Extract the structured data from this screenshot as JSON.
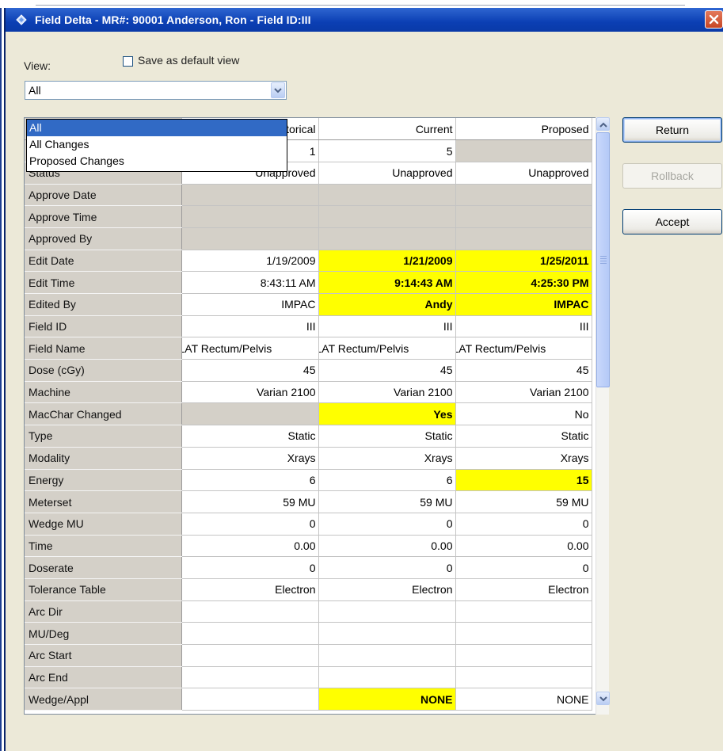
{
  "window": {
    "title": "Field Delta - MR#: 90001   Anderson, Ron - Field ID:III"
  },
  "view": {
    "label": "View:",
    "save_default_label": "Save as default view",
    "save_default_checked": false,
    "selected": "All",
    "options": [
      "All",
      "All Changes",
      "Proposed Changes"
    ]
  },
  "grid": {
    "columns": [
      "",
      "Historical",
      "Current",
      "Proposed"
    ],
    "rows": [
      {
        "label": "",
        "cells": [
          "1",
          "5",
          ""
        ],
        "gray": [
          false,
          false,
          true
        ]
      },
      {
        "label": "Status",
        "cells": [
          "Unapproved",
          "Unapproved",
          "Unapproved"
        ]
      },
      {
        "label": "Approve Date",
        "cells": [
          "",
          "",
          ""
        ],
        "gray": [
          true,
          true,
          true
        ]
      },
      {
        "label": "Approve Time",
        "cells": [
          "",
          "",
          ""
        ],
        "gray": [
          true,
          true,
          true
        ]
      },
      {
        "label": "Approved By",
        "cells": [
          "",
          "",
          ""
        ],
        "gray": [
          true,
          true,
          true
        ]
      },
      {
        "label": "Edit Date",
        "cells": [
          "1/19/2009",
          "1/21/2009",
          "1/25/2011"
        ],
        "hl": [
          false,
          true,
          true
        ]
      },
      {
        "label": "Edit Time",
        "cells": [
          "8:43:11 AM",
          "9:14:43 AM",
          "4:25:30 PM"
        ],
        "hl": [
          false,
          true,
          true
        ]
      },
      {
        "label": "Edited By",
        "cells": [
          "IMPAC",
          "Andy",
          "IMPAC"
        ],
        "hl": [
          false,
          true,
          true
        ]
      },
      {
        "label": "Field ID",
        "cells": [
          "III",
          "III",
          "III"
        ]
      },
      {
        "label": "Field Name",
        "cells": [
          "LAT Rectum/Pelvis",
          "LAT Rectum/Pelvis",
          "LAT Rectum/Pelvis"
        ],
        "clip": true
      },
      {
        "label": "Dose (cGy)",
        "cells": [
          "45",
          "45",
          "45"
        ]
      },
      {
        "label": "Machine",
        "cells": [
          "Varian 2100",
          "Varian 2100",
          "Varian 2100"
        ]
      },
      {
        "label": "MacChar Changed",
        "cells": [
          "",
          "Yes",
          "No"
        ],
        "gray": [
          true,
          false,
          false
        ],
        "hl": [
          false,
          true,
          false
        ]
      },
      {
        "label": "Type",
        "cells": [
          "Static",
          "Static",
          "Static"
        ]
      },
      {
        "label": "Modality",
        "cells": [
          "Xrays",
          "Xrays",
          "Xrays"
        ]
      },
      {
        "label": "Energy",
        "cells": [
          "6",
          "6",
          "15"
        ],
        "hl": [
          false,
          false,
          true
        ]
      },
      {
        "label": "Meterset",
        "cells": [
          "59 MU",
          "59 MU",
          "59 MU"
        ]
      },
      {
        "label": "Wedge MU",
        "cells": [
          "0",
          "0",
          "0"
        ]
      },
      {
        "label": "Time",
        "cells": [
          "0.00",
          "0.00",
          "0.00"
        ]
      },
      {
        "label": "Doserate",
        "cells": [
          "0",
          "0",
          "0"
        ]
      },
      {
        "label": "Tolerance Table",
        "cells": [
          "Electron",
          "Electron",
          "Electron"
        ]
      },
      {
        "label": "Arc Dir",
        "cells": [
          "",
          "",
          ""
        ]
      },
      {
        "label": "MU/Deg",
        "cells": [
          "",
          "",
          ""
        ]
      },
      {
        "label": "Arc Start",
        "cells": [
          "",
          "",
          ""
        ]
      },
      {
        "label": "Arc End",
        "cells": [
          "",
          "",
          ""
        ]
      },
      {
        "label": "Wedge/Appl",
        "cells": [
          "",
          "NONE",
          "NONE"
        ],
        "hl": [
          false,
          true,
          false
        ]
      }
    ]
  },
  "buttons": {
    "return": "Return",
    "rollback": "Rollback",
    "accept": "Accept"
  },
  "colors": {
    "titlebar": "#0b3fb4",
    "highlight": "#ffff00",
    "label_cell": "#d4d0c8",
    "selection": "#316ac5"
  }
}
